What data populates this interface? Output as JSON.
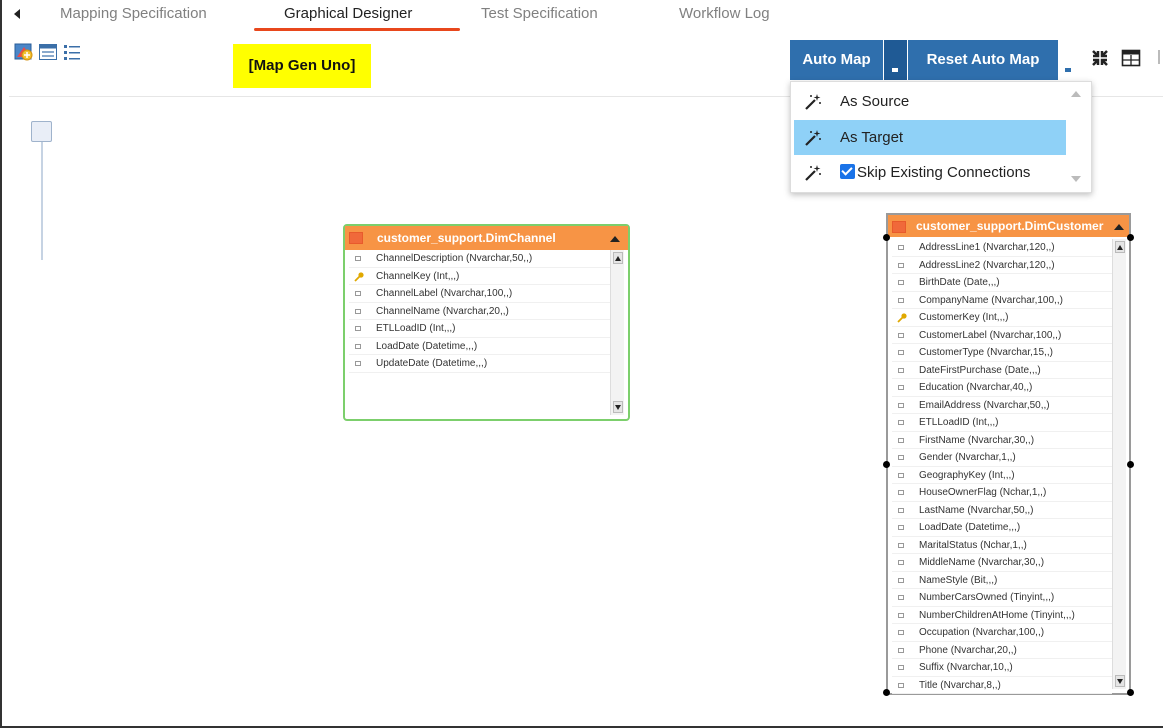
{
  "tabs": [
    {
      "label": "Mapping Specification",
      "active": false
    },
    {
      "label": "Graphical Designer",
      "active": true
    },
    {
      "label": "Test Specification",
      "active": false
    },
    {
      "label": "Workflow Log",
      "active": false
    }
  ],
  "toolbar": {
    "icons": [
      "rainbow-window-icon",
      "form-icon",
      "list-icon",
      "fit-icon",
      "table-view-icon"
    ],
    "auto_map_label": "Auto Map",
    "reset_auto_map_label": "Reset Auto Map"
  },
  "map_title": "[Map Gen Uno]",
  "dropdown": {
    "items": [
      {
        "label": "As Source",
        "selected": false
      },
      {
        "label": "As Target",
        "selected": true
      },
      {
        "label": "Skip Existing Connections",
        "selected": false,
        "checkbox": true,
        "checked": true
      }
    ]
  },
  "colors": {
    "accent_tab": "#e8471c",
    "button": "#2f6fad",
    "table_header": "#f79445",
    "highlight": "#ffff00",
    "selected_item": "#8fd1f7",
    "selected_table_border": "#7ccf6c"
  },
  "tables": {
    "channel": {
      "name": "customer_support.DimChannel",
      "columns": [
        {
          "label": "ChannelDescription (Nvarchar,50,,)",
          "key": false
        },
        {
          "label": "ChannelKey (Int,,,)",
          "key": true
        },
        {
          "label": "ChannelLabel (Nvarchar,100,,)",
          "key": false
        },
        {
          "label": "ChannelName (Nvarchar,20,,)",
          "key": false
        },
        {
          "label": "ETLLoadID (Int,,,)",
          "key": false
        },
        {
          "label": "LoadDate (Datetime,,,)",
          "key": false
        },
        {
          "label": "UpdateDate (Datetime,,,)",
          "key": false
        }
      ]
    },
    "customer": {
      "name": "customer_support.DimCustomer",
      "columns": [
        {
          "label": "AddressLine1 (Nvarchar,120,,)",
          "key": false
        },
        {
          "label": "AddressLine2 (Nvarchar,120,,)",
          "key": false
        },
        {
          "label": "BirthDate (Date,,,)",
          "key": false
        },
        {
          "label": "CompanyName (Nvarchar,100,,)",
          "key": false
        },
        {
          "label": "CustomerKey (Int,,,)",
          "key": true
        },
        {
          "label": "CustomerLabel (Nvarchar,100,,)",
          "key": false
        },
        {
          "label": "CustomerType (Nvarchar,15,,)",
          "key": false
        },
        {
          "label": "DateFirstPurchase (Date,,,)",
          "key": false
        },
        {
          "label": "Education (Nvarchar,40,,)",
          "key": false
        },
        {
          "label": "EmailAddress (Nvarchar,50,,)",
          "key": false
        },
        {
          "label": "ETLLoadID (Int,,,)",
          "key": false
        },
        {
          "label": "FirstName (Nvarchar,30,,)",
          "key": false
        },
        {
          "label": "Gender (Nvarchar,1,,)",
          "key": false
        },
        {
          "label": "GeographyKey (Int,,,)",
          "key": false
        },
        {
          "label": "HouseOwnerFlag (Nchar,1,,)",
          "key": false
        },
        {
          "label": "LastName (Nvarchar,50,,)",
          "key": false
        },
        {
          "label": "LoadDate (Datetime,,,)",
          "key": false
        },
        {
          "label": "MaritalStatus (Nchar,1,,)",
          "key": false
        },
        {
          "label": "MiddleName (Nvarchar,30,,)",
          "key": false
        },
        {
          "label": "NameStyle (Bit,,,)",
          "key": false
        },
        {
          "label": "NumberCarsOwned (Tinyint,,,)",
          "key": false
        },
        {
          "label": "NumberChildrenAtHome (Tinyint,,,)",
          "key": false
        },
        {
          "label": "Occupation (Nvarchar,100,,)",
          "key": false
        },
        {
          "label": "Phone (Nvarchar,20,,)",
          "key": false
        },
        {
          "label": "Suffix (Nvarchar,10,,)",
          "key": false
        },
        {
          "label": "Title (Nvarchar,8,,)",
          "key": false
        }
      ]
    }
  }
}
